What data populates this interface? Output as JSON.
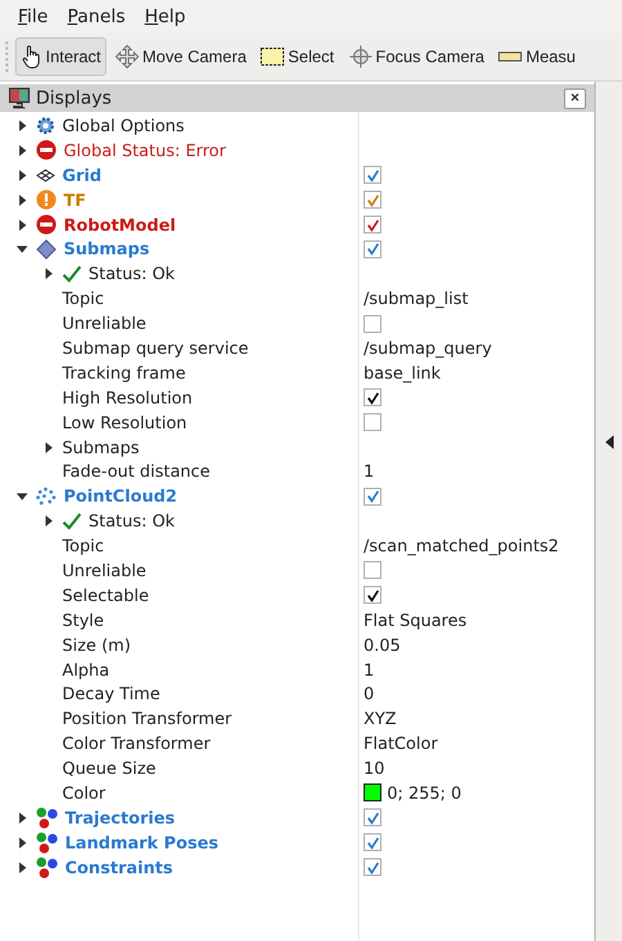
{
  "menu": [
    "File",
    "Panels",
    "Help"
  ],
  "toolbar": [
    {
      "label": "Interact",
      "kind": "hand",
      "selected": true
    },
    {
      "label": "Move Camera",
      "kind": "move",
      "selected": false
    },
    {
      "label": "Select",
      "kind": "select",
      "selected": false
    },
    {
      "label": "Focus Camera",
      "kind": "focus",
      "selected": false
    },
    {
      "label": "Measu",
      "kind": "ruler",
      "selected": false
    }
  ],
  "panel": {
    "title": "Displays",
    "close": "×"
  },
  "displays": [
    {
      "label": "Global Options",
      "kind": "gear",
      "color": "#222222",
      "expanded": false
    },
    {
      "label": "Global Status: Error",
      "kind": "error",
      "color": "#cc1a1a",
      "expanded": false
    },
    {
      "label": "Grid",
      "kind": "grid",
      "color": "#2a7ad0",
      "expanded": false,
      "checked": true
    },
    {
      "label": "TF",
      "kind": "warning",
      "color": "#c88000",
      "expanded": false,
      "checked": true
    },
    {
      "label": "RobotModel",
      "kind": "error",
      "color": "#cc1a1a",
      "expanded": false,
      "checked": true
    },
    {
      "label": "Submaps",
      "kind": "diamond",
      "color": "#2a7ad0",
      "expanded": true,
      "checked": true,
      "children": [
        {
          "label": "Status: Ok",
          "kind": "check",
          "expanded": false
        },
        {
          "label": "Topic",
          "value": "/submap_list"
        },
        {
          "label": "Unreliable",
          "checked": false
        },
        {
          "label": "Submap query service",
          "value": "/submap_query"
        },
        {
          "label": "Tracking frame",
          "value": "base_link"
        },
        {
          "label": "High Resolution",
          "checked": true
        },
        {
          "label": "Low Resolution",
          "checked": false
        },
        {
          "label": "Submaps",
          "expanded": false
        },
        {
          "label": "Fade-out distance",
          "value": "1"
        }
      ]
    },
    {
      "label": "PointCloud2",
      "kind": "points",
      "color": "#2a7ad0",
      "expanded": true,
      "checked": true,
      "children": [
        {
          "label": "Status: Ok",
          "kind": "check",
          "expanded": false
        },
        {
          "label": "Topic",
          "value": "/scan_matched_points2"
        },
        {
          "label": "Unreliable",
          "checked": false
        },
        {
          "label": "Selectable",
          "checked": true
        },
        {
          "label": "Style",
          "value": "Flat Squares"
        },
        {
          "label": "Size (m)",
          "value": "0.05"
        },
        {
          "label": "Alpha",
          "value": "1"
        },
        {
          "label": "Decay Time",
          "value": "0"
        },
        {
          "label": "Position Transformer",
          "value": "XYZ"
        },
        {
          "label": "Color Transformer",
          "value": "FlatColor"
        },
        {
          "label": "Queue Size",
          "value": "10"
        },
        {
          "label": "Color",
          "value": "0; 255; 0",
          "color": "#00ff00"
        }
      ]
    },
    {
      "label": "Trajectories",
      "kind": "markers",
      "color": "#2a7ad0",
      "expanded": false,
      "checked": true
    },
    {
      "label": "Landmark Poses",
      "kind": "markers",
      "color": "#2a7ad0",
      "expanded": false,
      "checked": true
    },
    {
      "label": "Constraints",
      "kind": "markers",
      "color": "#2a7ad0",
      "expanded": false,
      "checked": true
    }
  ]
}
